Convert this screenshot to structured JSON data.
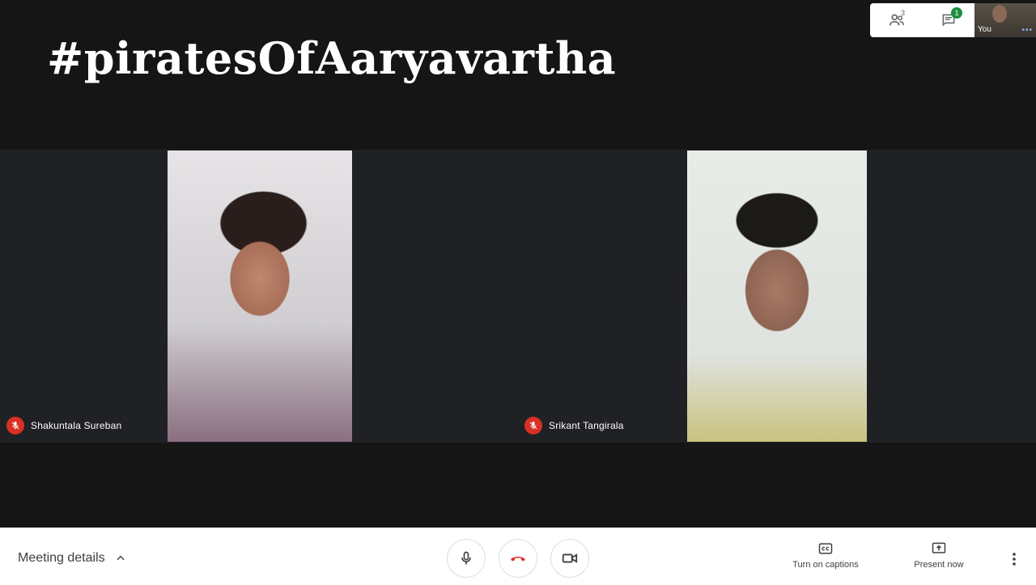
{
  "overlay": {
    "title": "#piratesOfAaryavartha"
  },
  "participants": [
    {
      "name": "Shakuntala Sureban",
      "muted": true
    },
    {
      "name": "Srikant Tangirala",
      "muted": true
    }
  ],
  "top_right": {
    "people_count": "3",
    "chat_badge": "1",
    "self_label": "You"
  },
  "bottom_bar": {
    "meeting_details_label": "Meeting details",
    "captions_label": "Turn on captions",
    "present_label": "Present now"
  },
  "colors": {
    "mute_red": "#d93025",
    "hangup_red": "#d93025",
    "badge_green": "#1e8e3e",
    "tile_bg": "#202124"
  },
  "icons": {
    "mic": "mic-icon",
    "hangup": "phone-hangup-icon",
    "camera": "videocam-icon",
    "captions": "closed-caption-icon",
    "present": "present-screen-icon",
    "more": "more-vert-icon",
    "people": "people-icon",
    "chat": "chat-icon",
    "chevron": "chevron-up-icon"
  }
}
